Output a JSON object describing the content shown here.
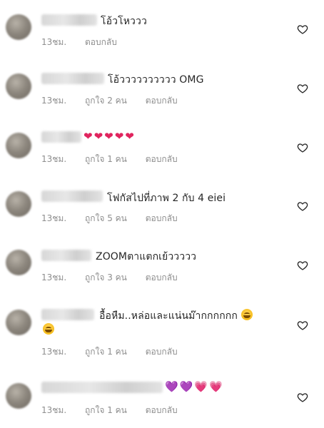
{
  "comments": [
    {
      "text": "โอ้วโหววว",
      "time": "13ชม.",
      "likes": "",
      "reply": "ตอบกลับ"
    },
    {
      "text": "โอ้วววววววววว OMG",
      "time": "13ชม.",
      "likes": "ถูกใจ 2 คน",
      "reply": "ตอบกลับ"
    },
    {
      "text": "❤❤❤❤❤",
      "time": "13ชม.",
      "likes": "ถูกใจ 1 คน",
      "reply": "ตอบกลับ"
    },
    {
      "text": "โฟกัสไปที่ภาพ 2 กับ 4 eiei",
      "time": "13ชม.",
      "likes": "ถูกใจ 5 คน",
      "reply": "ตอบกลับ"
    },
    {
      "text": "ZOOMตาแตกเย้ววววว",
      "time": "13ชม.",
      "likes": "ถูกใจ 3 คน",
      "reply": "ตอบกลับ"
    },
    {
      "text": "อื้อหืม..หล่อและแน่นม๊ากกกกกก",
      "time": "13ชม.",
      "likes": "ถูกใจ 1 คน",
      "reply": "ตอบกลับ"
    },
    {
      "text": "💜💜💗💗",
      "time": "13ชม.",
      "likes": "ถูกใจ 1 คน",
      "reply": "ตอบกลับ"
    }
  ],
  "icons": {
    "like": "heart-icon",
    "emoji": "grinning-face-emoji"
  },
  "colors": {
    "text": "#262626",
    "meta": "#8e8e8e",
    "heart_stroke": "#262626"
  }
}
